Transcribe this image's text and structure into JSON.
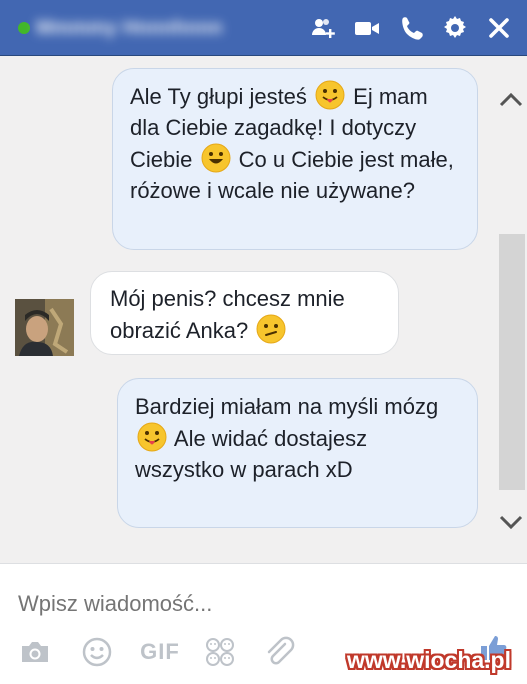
{
  "header": {
    "contact_name": "Mmmmy Hnnnhnnn",
    "online": true,
    "icons": [
      "add-friend-icon",
      "video-call-icon",
      "phone-icon",
      "settings-icon",
      "close-icon"
    ]
  },
  "messages": [
    {
      "sender": "me",
      "parts": [
        "Ale Ty głupi jesteś",
        "Ej mam dla Ciebie zagadkę! I dotyczy Ciebie",
        "Co u Ciebie jest małe, różowe i wcale nie używane?"
      ]
    },
    {
      "sender": "contact",
      "parts": [
        "Mój penis? chcesz mnie obrazić Anka?"
      ]
    },
    {
      "sender": "me",
      "parts": [
        "Bardziej miałam na myśli mózg",
        "Ale widać dostajesz wszystko w parach xD"
      ]
    }
  ],
  "composer": {
    "placeholder": "Wpisz wiadomość...",
    "gif_label": "GIF",
    "tools": [
      "camera-icon",
      "emoji-icon",
      "gif-button",
      "stickers-icon",
      "attachment-icon",
      "like-icon"
    ]
  },
  "watermark": "www.wiocha.pl",
  "colors": {
    "header": "#4267b2",
    "online": "#42b72a",
    "my_bubble": "#e8f0fb",
    "their_bubble": "#ffffff",
    "thread_bg": "#f1f0f0"
  }
}
